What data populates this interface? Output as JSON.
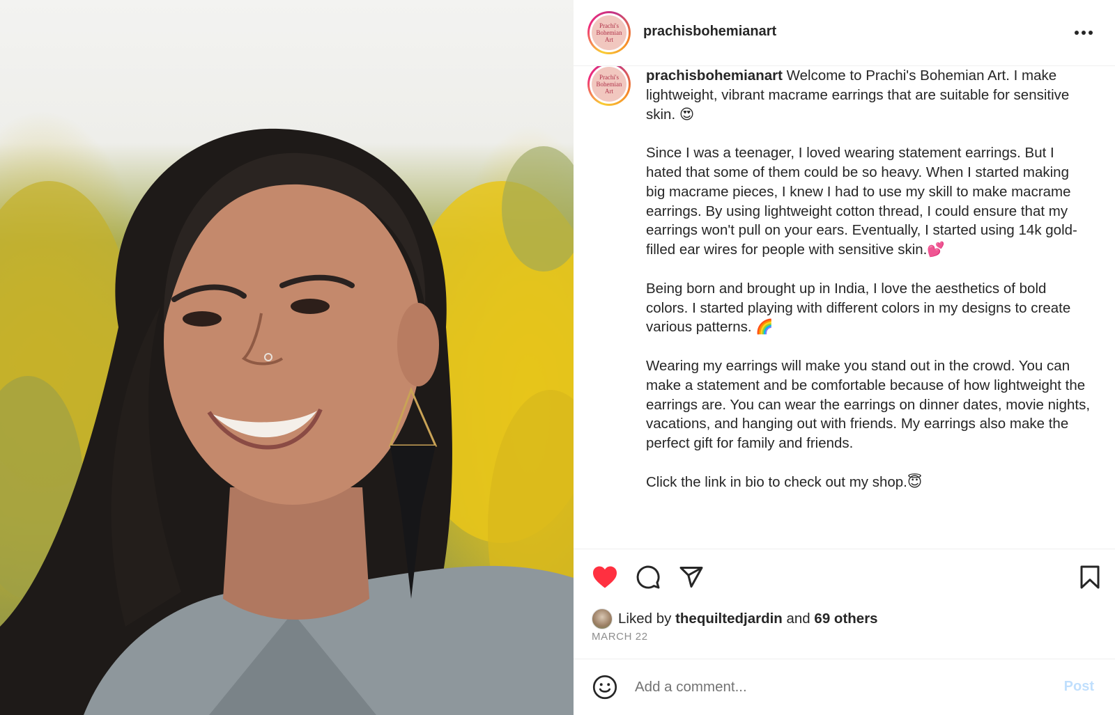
{
  "photo": {
    "alt_name": "profile-photo"
  },
  "header": {
    "avatar_text": [
      "Prachi's",
      "Bohemian",
      "Art"
    ],
    "username": "prachisbohemianart",
    "more_icon": "more-horizontal-icon"
  },
  "caption": {
    "avatar_text": [
      "Prachi's",
      "Bohemian",
      "Art"
    ],
    "username": "prachisbohemianart",
    "paragraphs": [
      " Welcome to Prachi's Bohemian Art. I make lightweight, vibrant macrame earrings that are suitable for sensitive skin. 😍",
      "Since I was a teenager, I loved wearing statement earrings. But I hated that some of them could be so heavy. When I started making big macrame pieces, I knew I had to use my skill to make macrame earrings. By using lightweight cotton thread, I could ensure that my earrings won't pull on your ears. Eventually, I started using 14k gold-filled ear wires for people with sensitive skin.💕",
      "Being born and brought up in India, I love the aesthetics of bold colors. I started playing with different colors in my designs to create various patterns. 🌈",
      "Wearing my earrings will make you stand out in the crowd. You can make a statement and be comfortable because of how lightweight the earrings are. You can wear the earrings on dinner dates, movie nights, vacations, and hanging out with friends. My earrings also make the perfect gift for family and friends.",
      "Click the link in bio to check out my shop.😇"
    ]
  },
  "actions": {
    "like_icon": "heart-filled-icon",
    "comment_icon": "comment-icon",
    "share_icon": "paper-plane-icon",
    "save_icon": "bookmark-icon",
    "like_color": "#ff3040"
  },
  "likes": {
    "prefix": "Liked by ",
    "user": "thequiltedjardin",
    "middle": " and ",
    "others": "69 others"
  },
  "date": "MARCH 22",
  "comment": {
    "emoji_icon": "smiley-icon",
    "placeholder": "Add a comment...",
    "post_label": "Post"
  }
}
